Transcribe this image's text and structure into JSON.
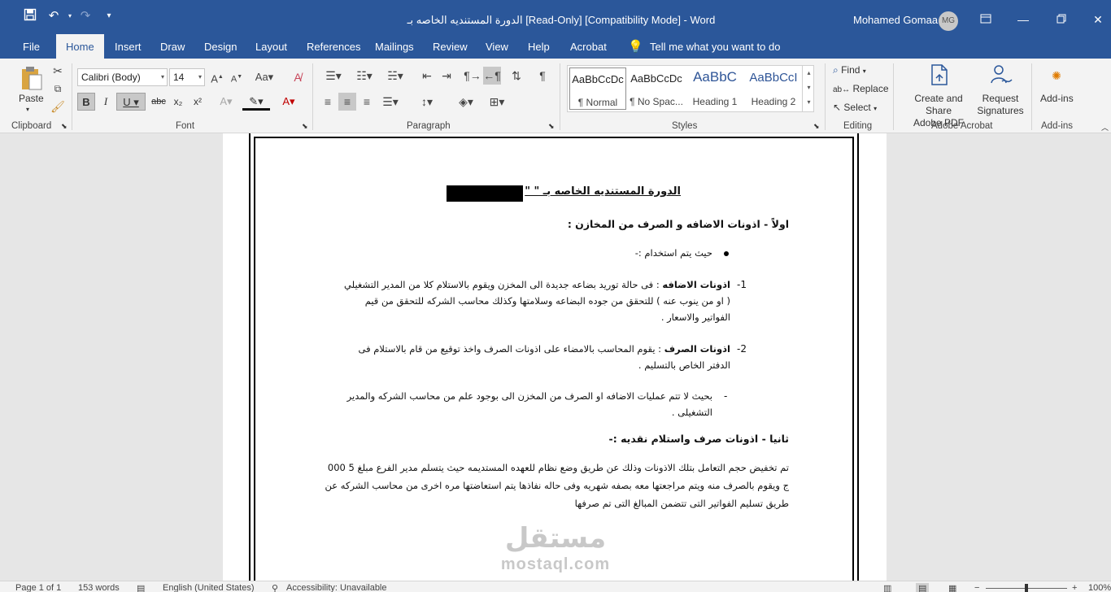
{
  "titlebar": {
    "title": "الدورة المستنديه الخاصه بـ [Read-Only] [Compatibility Mode]  -  Word",
    "user_name": "Mohamed Gomaa",
    "user_initials": "MG"
  },
  "tabs": [
    "File",
    "Home",
    "Insert",
    "Draw",
    "Design",
    "Layout",
    "References",
    "Mailings",
    "Review",
    "View",
    "Help",
    "Acrobat"
  ],
  "tell_me": "Tell me what you want to do",
  "ribbon": {
    "clipboard": {
      "paste_label": "Paste",
      "group_label": "Clipboard"
    },
    "font": {
      "font_name": "Calibri (Body)",
      "font_size": "14",
      "group_label": "Font"
    },
    "paragraph": {
      "group_label": "Paragraph"
    },
    "styles": {
      "group_label": "Styles",
      "items": [
        {
          "sample": "AaBbCcDc",
          "name": "¶ Normal"
        },
        {
          "sample": "AaBbCcDc",
          "name": "¶ No Spac..."
        },
        {
          "sample": "AaBbC",
          "name": "Heading 1"
        },
        {
          "sample": "AaBbCcI",
          "name": "Heading 2"
        }
      ]
    },
    "editing": {
      "find": "Find",
      "replace": "Replace",
      "select": "Select",
      "group_label": "Editing"
    },
    "acrobat": {
      "create_share_1": "Create and Share",
      "create_share_2": "Adobe PDF",
      "request_1": "Request",
      "request_2": "Signatures",
      "group_label": "Adobe Acrobat"
    },
    "addins": {
      "label": "Add-ins",
      "group_label": "Add-ins"
    }
  },
  "document": {
    "title": "الدورة المستنديه الخاصه بـ  \"                  \"",
    "section1_heading": "اولاً - اذونات الاضافه و الصرف من المخازن :",
    "bullet1": "حيث يتم استخدام :-",
    "item1_num": "-1",
    "item1_label": "اذونات الاضافه",
    "item1_text": " :  فى حالة توريد بضاعه جديدة الى المخزن ويقوم بالاستلام كلا من المدير التشغيلي ( او من ينوب عنه ) للتحقق من جوده البضاعه وسلامتها وكذلك محاسب الشركه للتحقق من قيم الفواتير والاسعار .",
    "item2_num": "-2",
    "item2_label": "اذونات الصرف",
    "item2_text": " :  يقوم المحاسب بالامضاء على اذونات الصرف واخذ توقيع من قام بالاستلام فى الدفتر الخاص بالتسليم .",
    "dash_item": "بحيث لا تتم عمليات الاضافه او الصرف من المخزن الى بوجود علم من محاسب الشركه والمدير التشغيلى .",
    "section2_heading": "ثانيا - اذونات صرف واستلام نقديه :-",
    "paragraph": "تم تخفيض حجم التعامل بتلك الاذونات وذلك عن طريق وضع نظام للعهده المستديمه حيث يتسلم مدير الفرع مبلغ 5 000 ج ويقوم بالصرف منه ويتم مراجعتها معه بصفه شهريه وفى حاله نفاذها يتم استعاضتها مره اخرى من محاسب الشركه عن طريق تسليم الفواتير التى تتضمن المبالغ التى تم صرفها"
  },
  "watermark": {
    "arabic": "مستقل",
    "latin": "mostaql.com"
  },
  "statusbar": {
    "page": "Page 1 of 1",
    "words": "153 words",
    "language": "English (United States)",
    "accessibility": "Accessibility: Unavailable",
    "zoom": "100%"
  }
}
